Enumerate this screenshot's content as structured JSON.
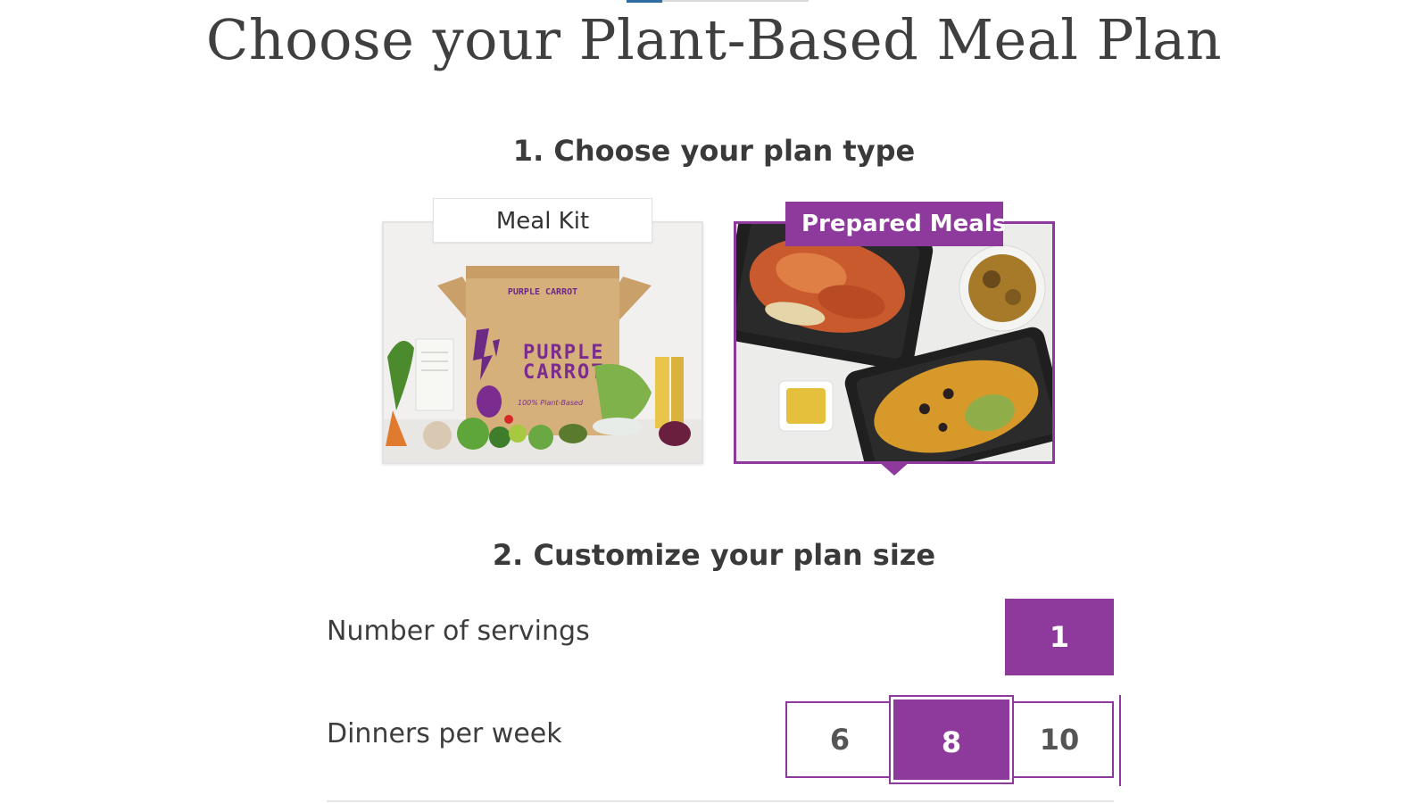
{
  "page": {
    "title": "Choose your Plant-Based Meal Plan"
  },
  "step1": {
    "heading": "1. Choose your plan type",
    "options": [
      {
        "label": "Meal Kit",
        "selected": false,
        "box_brand_line1": "PURPLE",
        "box_brand_line2": "CARROT",
        "box_top_text": "PURPLE CARROT",
        "box_tagline": "100% Plant-Based"
      },
      {
        "label": "Prepared Meals",
        "selected": true
      }
    ]
  },
  "step2": {
    "heading": "2. Customize your plan size",
    "servings": {
      "label": "Number of servings",
      "options": [
        "1"
      ],
      "selected": "1"
    },
    "dinners": {
      "label": "Dinners per week",
      "options": [
        "6",
        "8",
        "10"
      ],
      "selected": "8"
    }
  },
  "colors": {
    "accent": "#8e3a9d",
    "text": "#3c3c3c",
    "border": "#e3e3e3"
  }
}
